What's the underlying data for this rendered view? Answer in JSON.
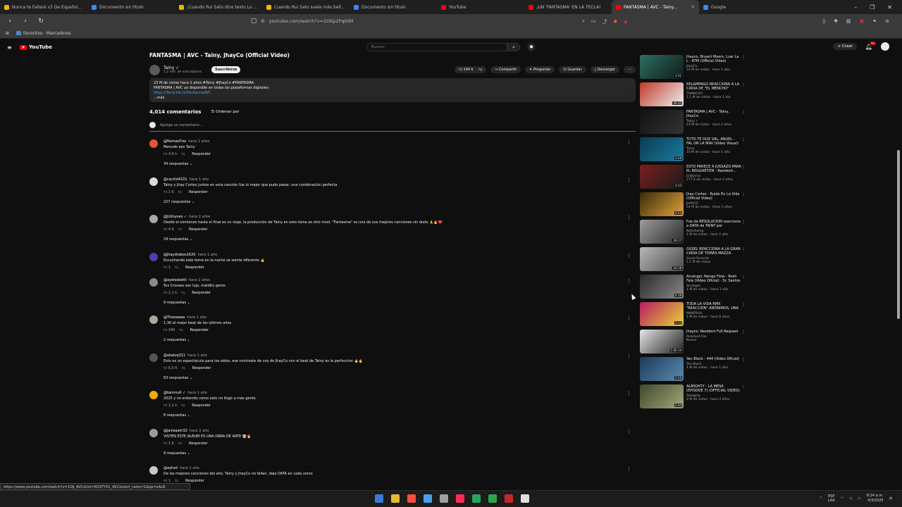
{
  "browser": {
    "tabs": [
      {
        "label": "Nunca te Fallaré v3 De Español CC",
        "color": "#f2b705",
        "active": false
      },
      {
        "label": "Documento sin título",
        "color": "#4285f4",
        "active": false
      },
      {
        "label": "¡Cuando Rui Sato dice texto Lo Bypad...",
        "color": "#f2b705",
        "active": false
      },
      {
        "label": "Cuando Rui Sato suele más bellos que...",
        "color": "#f2b705",
        "active": false
      },
      {
        "label": "Documento sin título",
        "color": "#4285f4",
        "active": false
      },
      {
        "label": "YouTube",
        "color": "#ff0000",
        "active": false
      },
      {
        "label": "¡UN 'FANTASMA' EN LA TECLA!",
        "color": "#ff0000",
        "active": false
      },
      {
        "label": "FANTASMA | AVC - Tainy...",
        "color": "#ff0000",
        "active": true
      },
      {
        "label": "Google",
        "color": "#4285f4",
        "active": false
      }
    ],
    "window_controls": [
      "–",
      "❐",
      "✕"
    ],
    "url": "youtube.com/watch?v=2OXp2PqIOM",
    "bookmarks": {
      "folder_label": "Favoritos · Marcadores"
    }
  },
  "yt_header": {
    "logo_text": "YouTube",
    "search_placeholder": "Buscar",
    "create_label": "+ Crear",
    "bell_badge": "9+"
  },
  "video": {
    "title": "FANTASMA | AVC - Tainy, JhayCo (Official Video)",
    "channel": "Tainy ✓",
    "subscribers": "1,2 mill. de suscriptores",
    "subscribe_label": "Suscribirse",
    "likes": "194 k",
    "actions": [
      "Compartir",
      "Preguntar",
      "Guardar",
      "Descargar"
    ],
    "description": {
      "line1": "23 M de vistas hace 2 años  #Tainy #JhayCo #FANTASMA",
      "line2": "FANTASMA | AVC ya disponible en todas las plataformas digitales:",
      "link": "https://Tainy.lnk.to/FantasmaAVC",
      "more": "...más"
    }
  },
  "comments_header": {
    "count": "4,014 comentarios",
    "sort_label": "Ordenar por",
    "add_placeholder": "Agrega un comentario..."
  },
  "comments": [
    {
      "author": "@Nomad7oo",
      "when": "hace 2 años",
      "text": "Menudo azo Tainy",
      "likes": "4,6 k",
      "replies": "34 respuestas",
      "color": "#e4572e"
    },
    {
      "author": "@cacilio4101",
      "when": "hace 1 año",
      "text": "Tainy y Jhay Cortez juntos en esta canción fue lo mejor que pudo pasar, una combinación perfecta",
      "likes": "1 K",
      "replies": "227 respuestas",
      "color": "#d9d9d9"
    },
    {
      "author": "@JLKnyves ✓",
      "when": "hace 2 años",
      "text": "Desde el comienzo hasta el final es un viaje, la producción de Tainy en este tema es otro nivel, \"Fantasma\" es una de sus mejores canciones sin duda 🙏🔥❤️",
      "likes": "4 K",
      "replies": "29 respuestas",
      "color": "#a8a8a8"
    },
    {
      "author": "@jhaydrabos1620",
      "when": "hace 1 año",
      "text": "Escuchando este tema en la noche se siente diferente 🔥",
      "likes": "1",
      "replies": "",
      "color": "#4a3fb5"
    },
    {
      "author": "@ayelosbetti",
      "when": "hace 2 años",
      "text": "Tus Crosses son lujo, maldito genio.",
      "likes": "1,1 k",
      "replies": "9 respuestas",
      "color": "#8a8a8a"
    },
    {
      "author": "@Thezawaa",
      "when": "hace 1 año",
      "text": "1:30 el mejor beat de los últimos años",
      "likes": "340",
      "replies": "2 respuestas",
      "color": "#b0a79a"
    },
    {
      "author": "@xkaluq311",
      "when": "hace 1 año",
      "text": "Esto es un espectáculo para los oídos, ese contraste de voz de JhayCo con el beat de Tainy es la perfección 🔥🔥",
      "likes": "6,5 K",
      "replies": "63 respuestas",
      "color": "#555555"
    },
    {
      "author": "@tannnull ✓",
      "when": "hace 1 año",
      "text": "2025 y no entiendo cómo esto no llegó a más gente",
      "likes": "1,2 k",
      "replies": "8 respuestas",
      "color": "#f2a900"
    },
    {
      "author": "@javisaam32",
      "when": "hace 1 año",
      "text": "VISTEN ESTE ÁLBUM ES UNA OBRA DE ARTE 👻🔥",
      "likes": "1 K",
      "replies": "9 respuestas",
      "color": "#9b9b9b"
    },
    {
      "author": "@ayhsd",
      "when": "hace 1 año",
      "text": "De las mejores canciones del año, Tainy y JhayCo no fallan, deja DATA en cada verso",
      "likes": "1",
      "replies": "",
      "color": "#c7c7c7"
    }
  ],
  "sidebar": [
    {
      "title": "Jhayco, Bryant Myers, Luar La L - KTM (Official Video)",
      "channel": "JhayCo",
      "stats": "31 M de vistas · hace 1 año",
      "dur": "3:31",
      "c1": "#2f6f5f",
      "c2": "#0d1b1a"
    },
    {
      "title": "RELÁMPAGO REACCIONA A LA CAÍDA DE \"EL MENCHO\"",
      "channel": "TUMACHO",
      "stats": "1,1 M de vistas · Hace 1 día",
      "dur": "45:35",
      "c1": "#c0392b",
      "c2": "#f0f0f0"
    },
    {
      "title": "FANTASMA | AVC - Tainy, JhayCo",
      "channel": "Tainy ✓",
      "stats": "23 M de vistas · hace 2 años",
      "dur": "",
      "c1": "#111111",
      "c2": "#333333"
    },
    {
      "title": "TUTO TE DOZ VAL, ANUEL - FAL OR LA MIAI (Video Visual)",
      "channel": "Tainy",
      "stats": "10 M de vistas · hace 1 año",
      "dur": "3:28",
      "c1": "#0c3c52",
      "c2": "#1b7a9d"
    },
    {
      "title": "ESTO PARECE A JUSSAZO PARA EL REGGAETÓN - Resident...",
      "channel": "EnBarros",
      "stats": "277 K de vistas · hace 3 años",
      "dur": "4:33",
      "c1": "#7b1e1e",
      "c2": "#1a1a1a"
    },
    {
      "title": "Jhay Cortez - Ruido En La Vida (Official Video)",
      "channel": "JHAYCO",
      "stats": "54 M de vistas · Hace 5 años",
      "dur": "4:24",
      "c1": "#3a2a0a",
      "c2": "#e0a33a"
    },
    {
      "title": "Fue de RESOLUCIÓN reacciona a DATA de TAINY por PRIMERA...",
      "channel": "Notichamp",
      "stats": "1 M de vistas · hace 1 año",
      "dur": "29:17",
      "c1": "#9d9d9d",
      "c2": "#2a2a2a"
    },
    {
      "title": "GUSEL REACCIONA A LA GRAN CAÍDA DE TOMÁS MAZZA",
      "channel": "Gusel Records",
      "stats": "1,1 M de vistas",
      "dur": "16:18",
      "c1": "#b8b8b8",
      "c2": "#4a4a4a"
    },
    {
      "title": "Arcángel, Ñengo Flow - Rosh Fala (Video Oficial) · Sr. Santos",
      "channel": "Arcángel",
      "stats": "1 M de vistas · Hace 1 año",
      "dur": "4:19",
      "c1": "#2b2b2b",
      "c2": "#888888"
    },
    {
      "title": "TODA LA VIDA RMX \"REACCIÓN\" ANÓNIMOS, UNA",
      "channel": "MANFRUA",
      "stats": "1 M de vistas · hace 6 años",
      "dur": "1:13",
      "c1": "#b71c5e",
      "c2": "#e9d13a"
    },
    {
      "title": "Jhayco: Resident Full Request",
      "channel": "Resident Fan",
      "stats": "Nuevo",
      "dur": "1:02:14",
      "c1": "#e6e6e6",
      "c2": "#222222"
    },
    {
      "title": "Yan Block - 444 (Video Oficial)",
      "channel": "Yan Block",
      "stats": "1 M de vistas · hace 1 año",
      "dur": "3:16",
      "c1": "#1d3a5a",
      "c2": "#5a8ab0"
    },
    {
      "title": "ALMIGHTY - LA MESA (EPISODE 7) (OFFICIAL VIDEO)",
      "channel": "Almighty",
      "stats": "2 M de vistas · hace 4 años",
      "dur": "2:20",
      "c1": "#3f4a2a",
      "c2": "#a5a57a"
    }
  ],
  "status_url": "https://www.youtube.com/watch?v=1OJi_AVC&list=RD3TYS1_AVC&start_radio=1&pp=oAcB",
  "taskbar": {
    "icons": [
      "#3a7bd5",
      "#e8b83a",
      "#ff4f38",
      "#4a9eed",
      "#9aa0a6",
      "#ff2d55",
      "#25a55a",
      "#2aa84a",
      "#c62828",
      "#e0e0e0"
    ],
    "lang": "ESP\nLAA",
    "time": "8:24 a.m.",
    "date": "4/3/2025"
  }
}
